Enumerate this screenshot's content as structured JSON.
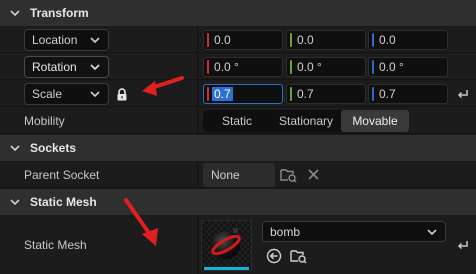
{
  "transform": {
    "header": "Transform",
    "location": {
      "label": "Location",
      "x": "0.0",
      "y": "0.0",
      "z": "0.0"
    },
    "rotation": {
      "label": "Rotation",
      "x": "0.0 °",
      "y": "0.0 °",
      "z": "0.0 °"
    },
    "scale": {
      "label": "Scale",
      "x": "0.7",
      "y": "0.7",
      "z": "0.7"
    },
    "mobility": {
      "label": "Mobility",
      "options": [
        "Static",
        "Stationary",
        "Movable"
      ],
      "selected": "Movable"
    }
  },
  "sockets": {
    "header": "Sockets",
    "parent_socket": {
      "label": "Parent Socket",
      "value": "None"
    }
  },
  "static_mesh": {
    "header": "Static Mesh",
    "label": "Static Mesh",
    "asset": "bomb"
  },
  "colors": {
    "axis_x": "#c6332f",
    "axis_y": "#6aa23a",
    "axis_z": "#2f6ac8",
    "annotation_arrow": "#e0201e",
    "thumbnail_accent": "#17b0d8"
  },
  "icons": {
    "collapse": "chevron-down-icon",
    "lock": "lock-icon",
    "reset": "reset-to-default-icon",
    "browse": "browse-folder-icon",
    "clear": "clear-x-icon",
    "use_selected": "use-selected-arrow-icon",
    "annotation": "red-arrow-annotation"
  }
}
